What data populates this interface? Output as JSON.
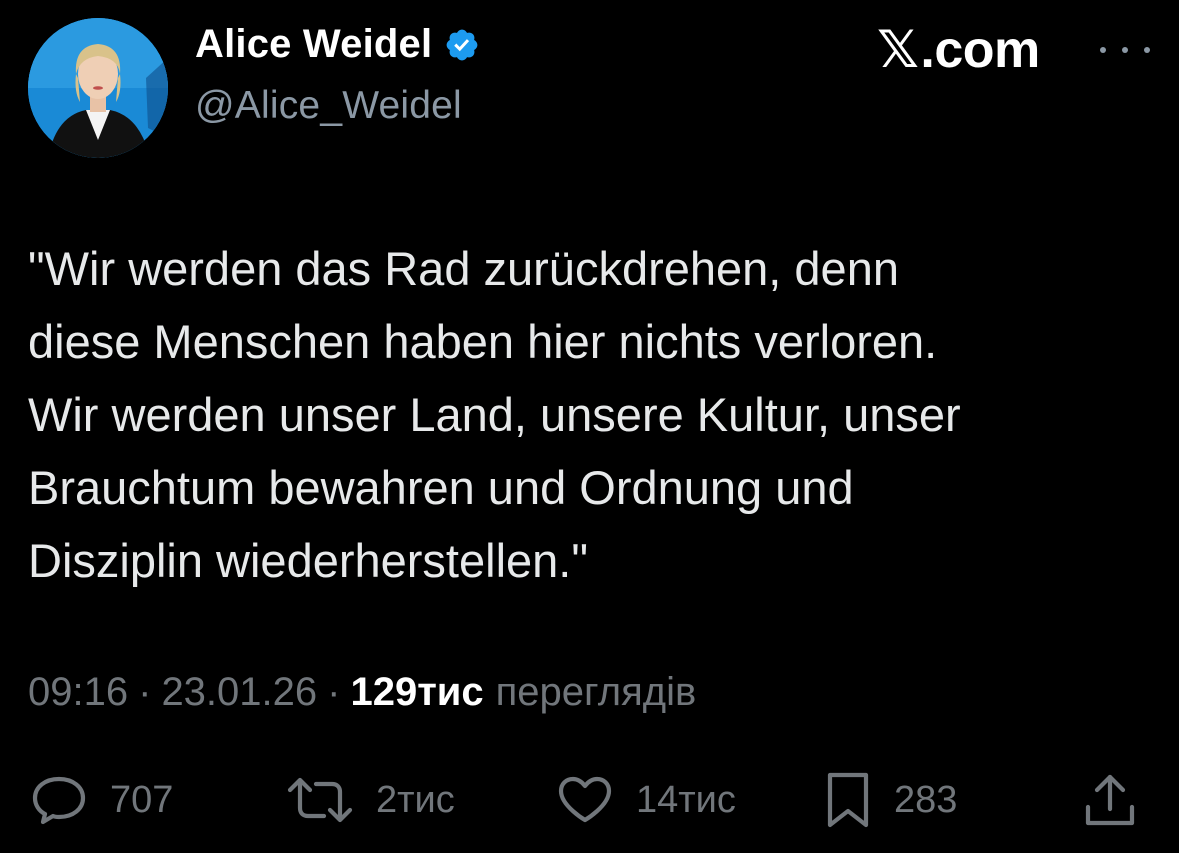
{
  "author": {
    "name": "Alice Weidel",
    "handle": "@Alice_Weidel",
    "verified": true,
    "verified_color": "#1d9bf0"
  },
  "site": {
    "glyph": "𝕏",
    "suffix": ".com"
  },
  "tweet": {
    "text": "\"Wir werden das Rad zurückdrehen, denn\ndiese Menschen haben hier nichts verloren.\nWir werden unser Land, unsere Kultur, unser\nBrauchtum bewahren und Ordnung und\nDisziplin wiederherstellen.\""
  },
  "meta": {
    "time": "09:16",
    "separator": "·",
    "date": "23.01.26",
    "views_count": "129тис",
    "views_label": "переглядів"
  },
  "actions": {
    "replies": "707",
    "reposts": "2тис",
    "likes": "14тис",
    "bookmarks": "283"
  },
  "icons": {
    "more": "more-icon",
    "reply": "reply-icon",
    "repost": "repost-icon",
    "like": "like-icon",
    "bookmark": "bookmark-icon",
    "share": "share-icon"
  },
  "colors": {
    "background": "#000000",
    "text": "#e7e9ea",
    "secondary": "#71767b",
    "accent": "#1d9bf0"
  }
}
